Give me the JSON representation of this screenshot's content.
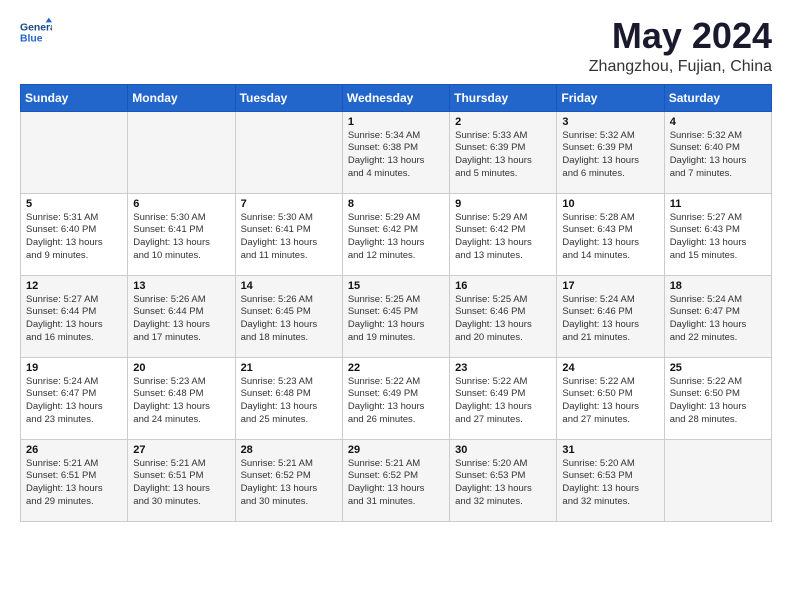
{
  "header": {
    "logo_line1": "General",
    "logo_line2": "Blue",
    "month": "May 2024",
    "location": "Zhangzhou, Fujian, China"
  },
  "days_of_week": [
    "Sunday",
    "Monday",
    "Tuesday",
    "Wednesday",
    "Thursday",
    "Friday",
    "Saturday"
  ],
  "weeks": [
    [
      {
        "day": "",
        "info": ""
      },
      {
        "day": "",
        "info": ""
      },
      {
        "day": "",
        "info": ""
      },
      {
        "day": "1",
        "info": "Sunrise: 5:34 AM\nSunset: 6:38 PM\nDaylight: 13 hours\nand 4 minutes."
      },
      {
        "day": "2",
        "info": "Sunrise: 5:33 AM\nSunset: 6:39 PM\nDaylight: 13 hours\nand 5 minutes."
      },
      {
        "day": "3",
        "info": "Sunrise: 5:32 AM\nSunset: 6:39 PM\nDaylight: 13 hours\nand 6 minutes."
      },
      {
        "day": "4",
        "info": "Sunrise: 5:32 AM\nSunset: 6:40 PM\nDaylight: 13 hours\nand 7 minutes."
      }
    ],
    [
      {
        "day": "5",
        "info": "Sunrise: 5:31 AM\nSunset: 6:40 PM\nDaylight: 13 hours\nand 9 minutes."
      },
      {
        "day": "6",
        "info": "Sunrise: 5:30 AM\nSunset: 6:41 PM\nDaylight: 13 hours\nand 10 minutes."
      },
      {
        "day": "7",
        "info": "Sunrise: 5:30 AM\nSunset: 6:41 PM\nDaylight: 13 hours\nand 11 minutes."
      },
      {
        "day": "8",
        "info": "Sunrise: 5:29 AM\nSunset: 6:42 PM\nDaylight: 13 hours\nand 12 minutes."
      },
      {
        "day": "9",
        "info": "Sunrise: 5:29 AM\nSunset: 6:42 PM\nDaylight: 13 hours\nand 13 minutes."
      },
      {
        "day": "10",
        "info": "Sunrise: 5:28 AM\nSunset: 6:43 PM\nDaylight: 13 hours\nand 14 minutes."
      },
      {
        "day": "11",
        "info": "Sunrise: 5:27 AM\nSunset: 6:43 PM\nDaylight: 13 hours\nand 15 minutes."
      }
    ],
    [
      {
        "day": "12",
        "info": "Sunrise: 5:27 AM\nSunset: 6:44 PM\nDaylight: 13 hours\nand 16 minutes."
      },
      {
        "day": "13",
        "info": "Sunrise: 5:26 AM\nSunset: 6:44 PM\nDaylight: 13 hours\nand 17 minutes."
      },
      {
        "day": "14",
        "info": "Sunrise: 5:26 AM\nSunset: 6:45 PM\nDaylight: 13 hours\nand 18 minutes."
      },
      {
        "day": "15",
        "info": "Sunrise: 5:25 AM\nSunset: 6:45 PM\nDaylight: 13 hours\nand 19 minutes."
      },
      {
        "day": "16",
        "info": "Sunrise: 5:25 AM\nSunset: 6:46 PM\nDaylight: 13 hours\nand 20 minutes."
      },
      {
        "day": "17",
        "info": "Sunrise: 5:24 AM\nSunset: 6:46 PM\nDaylight: 13 hours\nand 21 minutes."
      },
      {
        "day": "18",
        "info": "Sunrise: 5:24 AM\nSunset: 6:47 PM\nDaylight: 13 hours\nand 22 minutes."
      }
    ],
    [
      {
        "day": "19",
        "info": "Sunrise: 5:24 AM\nSunset: 6:47 PM\nDaylight: 13 hours\nand 23 minutes."
      },
      {
        "day": "20",
        "info": "Sunrise: 5:23 AM\nSunset: 6:48 PM\nDaylight: 13 hours\nand 24 minutes."
      },
      {
        "day": "21",
        "info": "Sunrise: 5:23 AM\nSunset: 6:48 PM\nDaylight: 13 hours\nand 25 minutes."
      },
      {
        "day": "22",
        "info": "Sunrise: 5:22 AM\nSunset: 6:49 PM\nDaylight: 13 hours\nand 26 minutes."
      },
      {
        "day": "23",
        "info": "Sunrise: 5:22 AM\nSunset: 6:49 PM\nDaylight: 13 hours\nand 27 minutes."
      },
      {
        "day": "24",
        "info": "Sunrise: 5:22 AM\nSunset: 6:50 PM\nDaylight: 13 hours\nand 27 minutes."
      },
      {
        "day": "25",
        "info": "Sunrise: 5:22 AM\nSunset: 6:50 PM\nDaylight: 13 hours\nand 28 minutes."
      }
    ],
    [
      {
        "day": "26",
        "info": "Sunrise: 5:21 AM\nSunset: 6:51 PM\nDaylight: 13 hours\nand 29 minutes."
      },
      {
        "day": "27",
        "info": "Sunrise: 5:21 AM\nSunset: 6:51 PM\nDaylight: 13 hours\nand 30 minutes."
      },
      {
        "day": "28",
        "info": "Sunrise: 5:21 AM\nSunset: 6:52 PM\nDaylight: 13 hours\nand 30 minutes."
      },
      {
        "day": "29",
        "info": "Sunrise: 5:21 AM\nSunset: 6:52 PM\nDaylight: 13 hours\nand 31 minutes."
      },
      {
        "day": "30",
        "info": "Sunrise: 5:20 AM\nSunset: 6:53 PM\nDaylight: 13 hours\nand 32 minutes."
      },
      {
        "day": "31",
        "info": "Sunrise: 5:20 AM\nSunset: 6:53 PM\nDaylight: 13 hours\nand 32 minutes."
      },
      {
        "day": "",
        "info": ""
      }
    ]
  ]
}
